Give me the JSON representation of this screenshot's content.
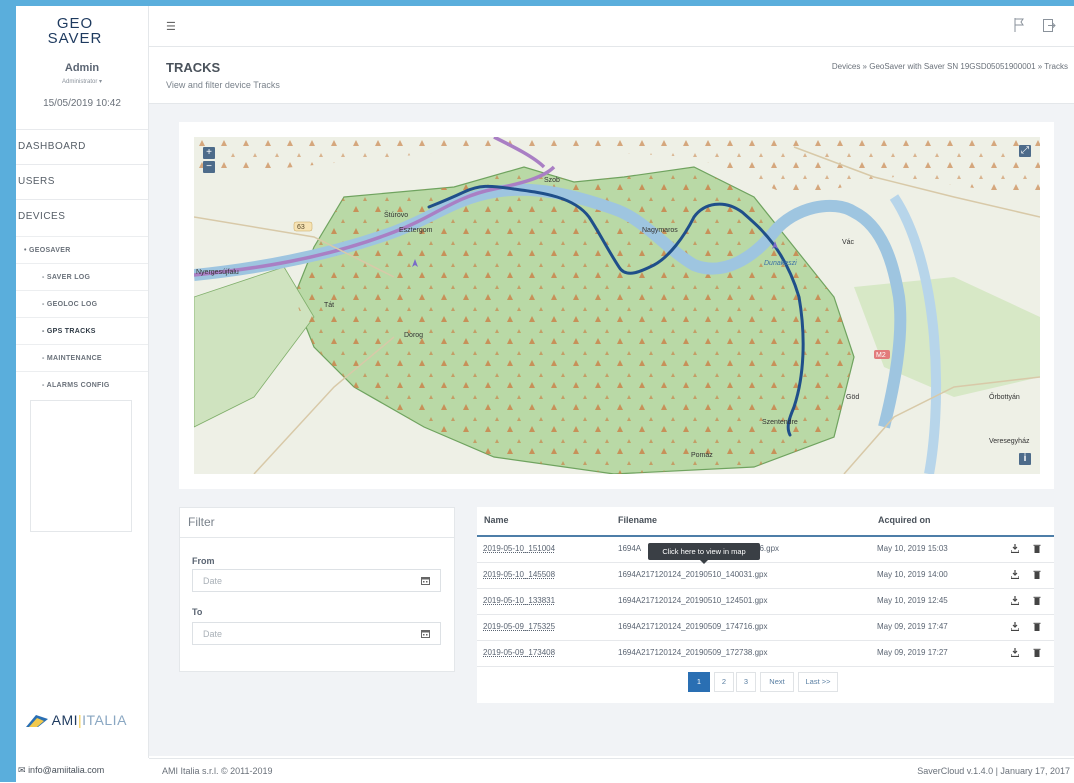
{
  "app": {
    "logo_line1": "GEO",
    "logo_line2": "SAVER",
    "ami_logo": "AMI",
    "ami_logo_suffix": "ITALIA"
  },
  "user": {
    "name": "Admin",
    "role": "Administrator ▾",
    "datetime": "15/05/2019 10:42"
  },
  "nav": {
    "dashboard": "DASHBOARD",
    "users": "USERS",
    "devices": "DEVICES",
    "geosaver": "• GEOSAVER",
    "saver_log": "- SAVER LOG",
    "geoloc_log": "- GEOLOC LOG",
    "gps_tracks": "- GPS TRACKS",
    "maintenance": "- MAINTENANCE",
    "alarms_config": "- ALARMS CONFIG"
  },
  "header": {
    "title": "TRACKS",
    "subtitle": "View and filter device Tracks",
    "breadcrumb": "Devices » GeoSaver with Saver SN 19GSD05051900001 » Tracks"
  },
  "map": {
    "zoom_in": "+",
    "zoom_out": "−",
    "fullscreen": "⤢",
    "info": "i",
    "towns": [
      "Szob",
      "Štúrovo",
      "Esztergom",
      "Nyergesújfalu",
      "Tát",
      "Dorog",
      "Nagymaros",
      "Dunakeszi",
      "Vác",
      "Göd",
      "Őrbottyán",
      "Szentendre",
      "Pomáz",
      "Veresegyház"
    ],
    "road_labels": [
      "63",
      "M2"
    ],
    "colors": {
      "track": "#1f4f8a",
      "border_river": "#a97fc4",
      "water": "#a9cce3",
      "forest": "#b7d8a8"
    }
  },
  "filter": {
    "title": "Filter",
    "from_label": "From",
    "from_placeholder": "Date",
    "to_label": "To",
    "to_placeholder": "Date"
  },
  "tracks_table": {
    "columns": [
      "Name",
      "Filename",
      "Acquired on"
    ],
    "rows": [
      {
        "name": "2019-05-10_151004",
        "filename": "1694A",
        "filename_tail": "56.gpx",
        "acquired": "May 10, 2019 15:03"
      },
      {
        "name": "2019-05-10_145508",
        "filename": "1694A217120124_20190510_140031.gpx",
        "filename_tail": "",
        "acquired": "May 10, 2019 14:00"
      },
      {
        "name": "2019-05-10_133831",
        "filename": "1694A217120124_20190510_124501.gpx",
        "filename_tail": "",
        "acquired": "May 10, 2019 12:45"
      },
      {
        "name": "2019-05-09_175325",
        "filename": "1694A217120124_20190509_174716.gpx",
        "filename_tail": "",
        "acquired": "May 09, 2019 17:47"
      },
      {
        "name": "2019-05-09_173408",
        "filename": "1694A217120124_20190509_172738.gpx",
        "filename_tail": "",
        "acquired": "May 09, 2019 17:27"
      }
    ],
    "tooltip": "Click here to view in map"
  },
  "pagination": {
    "pages": [
      "1",
      "2",
      "3"
    ],
    "next": "Next",
    "last": "Last >>",
    "current": "1"
  },
  "footer": {
    "email": "info@amiitalia.com",
    "copyright": "AMI Italia s.r.l. © 2011-2019",
    "version": "SaverCloud v.1.4.0 | January 17, 2017"
  }
}
